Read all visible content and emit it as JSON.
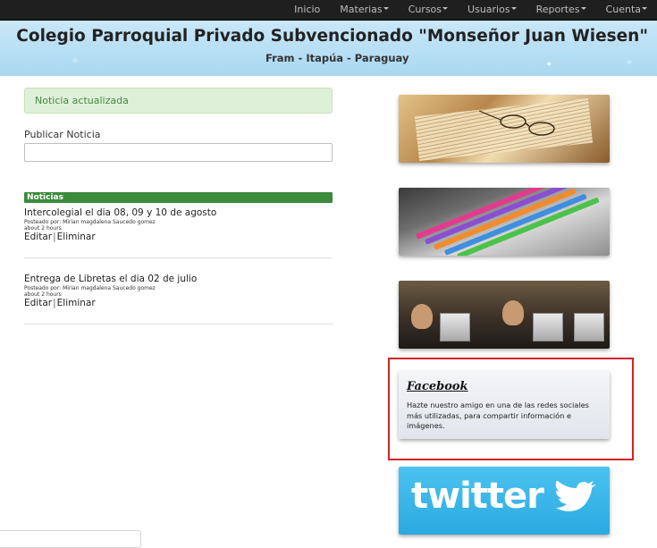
{
  "nav": {
    "items": [
      {
        "label": "Inicio",
        "dropdown": false
      },
      {
        "label": "Materias",
        "dropdown": true
      },
      {
        "label": "Cursos",
        "dropdown": true
      },
      {
        "label": "Usuarios",
        "dropdown": true
      },
      {
        "label": "Reportes",
        "dropdown": true
      },
      {
        "label": "Cuenta",
        "dropdown": true
      }
    ]
  },
  "header": {
    "title": "Colegio Parroquial Privado Subvencionado \"Monseñor Juan Wiesen\"",
    "subtitle": "Fram - Itapúa - Paraguay"
  },
  "alert": {
    "text": "Noticia actualizada"
  },
  "publish": {
    "label": "Publicar Noticia",
    "value": ""
  },
  "news_section": {
    "heading": "Noticias"
  },
  "news": [
    {
      "title": "Intercolegial el dia 08, 09 y 10 de agosto",
      "author": "Posteado por: Mirian magdalena Saucedo gomez",
      "time": "about 2 hours",
      "edit": "Editar",
      "delete": "Eliminar"
    },
    {
      "title": "Entrega de Libretas el dia 02 de julio",
      "author": "Posteado por: Mirian magdalena Saucedo gomez",
      "time": "about 2 hours",
      "edit": "Editar",
      "delete": "Eliminar"
    }
  ],
  "sidebar": {
    "facebook": {
      "title": "Facebook",
      "text": "Hazte nuestro amigo en una de las redes sociales más utilizadas, para compartir información e imágenes."
    },
    "twitter": {
      "wordmark": "twitter"
    }
  },
  "colors": {
    "nav_bg": "#1f1f1f",
    "banner": "#b5def3",
    "alert_bg": "#dff0d8",
    "alert_text": "#468847",
    "news_bar": "#3a8b3a",
    "highlight": "#d32228",
    "twitter": "#33b3e8"
  }
}
